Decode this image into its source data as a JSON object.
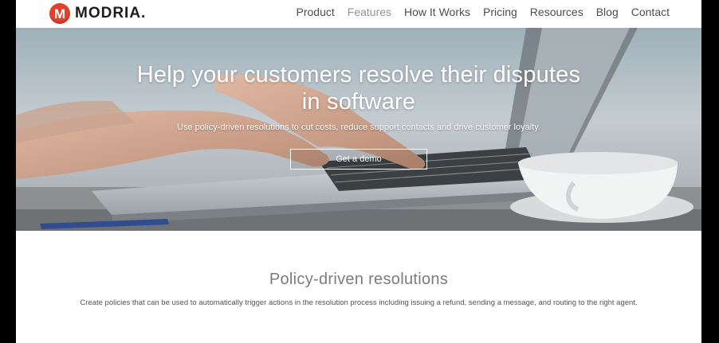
{
  "brand": {
    "logo_letter": "M",
    "name": "MODRIA.",
    "accent": "#e2402a"
  },
  "nav": {
    "items": [
      {
        "label": "Product"
      },
      {
        "label": "Features",
        "active": true
      },
      {
        "label": "How It Works"
      },
      {
        "label": "Pricing"
      },
      {
        "label": "Resources"
      },
      {
        "label": "Blog"
      },
      {
        "label": "Contact"
      }
    ]
  },
  "hero": {
    "title": "Help your customers resolve their disputes in software",
    "subtitle": "Use policy-driven resolutions to cut costs, reduce support contacts and drive customer loyalty.",
    "cta_label": "Get a demo"
  },
  "section": {
    "title": "Policy-driven resolutions",
    "text": "Create policies that can be used to automatically trigger actions in the resolution process including issuing a refund, sending a message, and routing to the right agent."
  }
}
